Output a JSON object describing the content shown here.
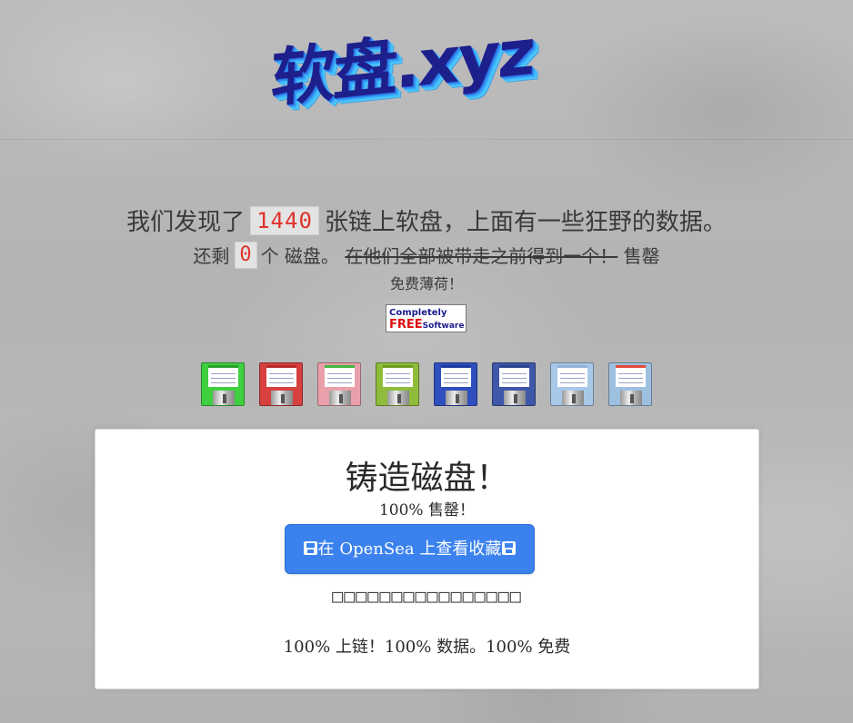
{
  "logo": {
    "text": "软盘.xyz"
  },
  "headline": {
    "prefix": "我们发现了",
    "count": "1440",
    "suffix": "张链上软盘，上面有一些狂野的数据。"
  },
  "remaining": {
    "prefix": "还剩",
    "count": "0",
    "middle": "个 磁盘。",
    "struck": "在他们全部被带走之前得到一个！",
    "soldout": "售罄"
  },
  "free_note": "免费薄荷！",
  "free_badge": {
    "line1": "Completely",
    "line2a": "FREE",
    "line2b": "Software"
  },
  "disks": [
    {
      "name": "green-floppy-icon",
      "color": "#3fcf3f",
      "label_color": "#2aa02a"
    },
    {
      "name": "red-floppy-icon",
      "color": "#d6403f",
      "label_color": "#b52a2a"
    },
    {
      "name": "pink-floppy-icon",
      "color": "#e9a0aa",
      "label_color": "#3fb83f"
    },
    {
      "name": "olive-floppy-icon",
      "color": "#8fbc3a",
      "label_color": "#6e9a25"
    },
    {
      "name": "blue-floppy-icon",
      "color": "#2f4fbf",
      "label_color": "#1f3a9c"
    },
    {
      "name": "navy-floppy-icon",
      "color": "#3f57a8",
      "label_color": "#2c4390"
    },
    {
      "name": "lightblue-floppy-icon",
      "color": "#a8c8e8",
      "label_color": "#8fb2d8"
    },
    {
      "name": "skyblue-floppy-icon",
      "color": "#9ec0e0",
      "label_color": "#e04a3a"
    }
  ],
  "card": {
    "title": "铸造磁盘！",
    "subtitle": "100% 售罄！",
    "button_label": "在 OpenSea 上查看收藏",
    "missing_glyphs": "□□□□□□□□□□□□□□□□",
    "footer": "100% 上链！100% 数据。100% 免费"
  },
  "colors": {
    "accent": "#3b82ee",
    "counter_text": "#e0322a",
    "logo_face": "#1d1f8c",
    "logo_extrude": "#46c2fb"
  }
}
